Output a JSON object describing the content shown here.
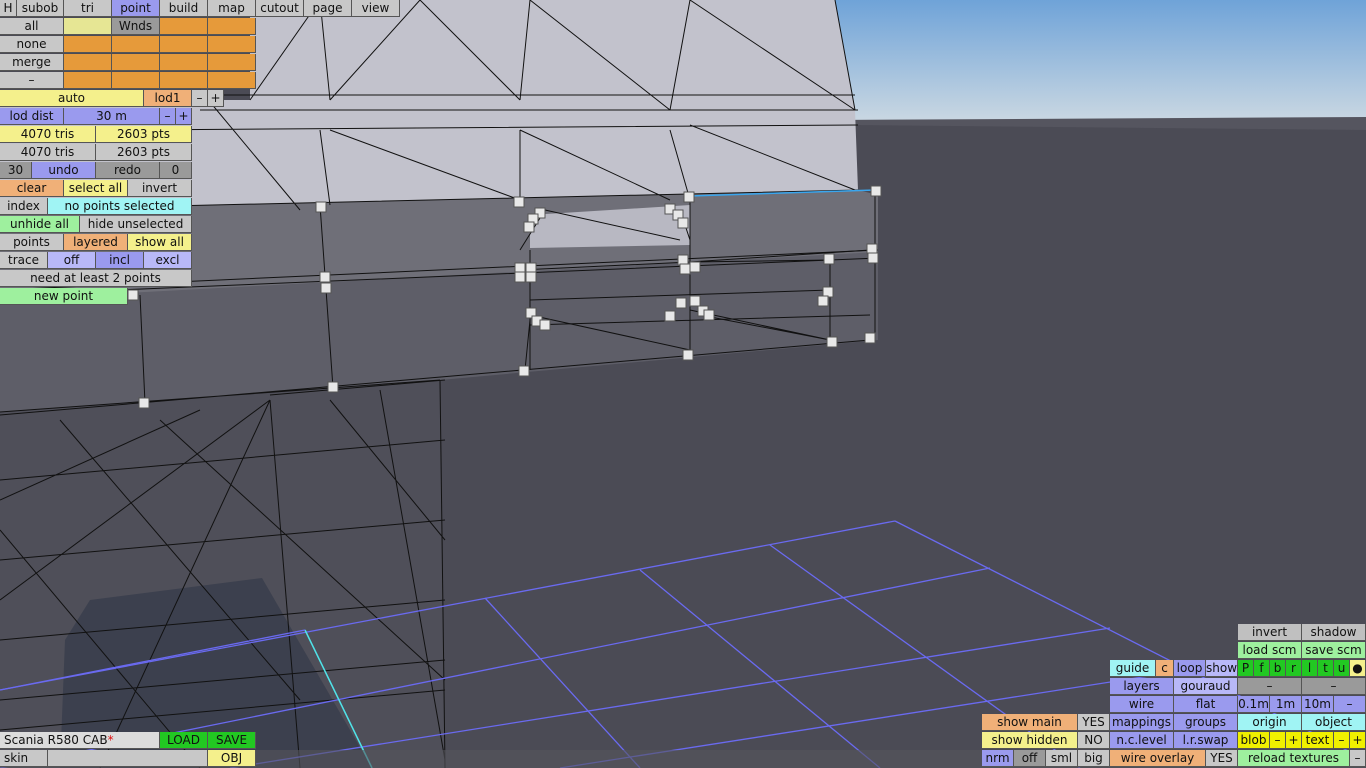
{
  "topbar": {
    "h": "H",
    "subob": "subob",
    "tri": "tri",
    "point": "point",
    "build": "build",
    "map": "map",
    "cutout": "cutout",
    "page": "page",
    "view": "view"
  },
  "selectors": {
    "all": "all",
    "none": "none",
    "merge": "merge",
    "minus": "–",
    "wnds": "Wnds"
  },
  "lod": {
    "auto": "auto",
    "lod1": "lod1",
    "minus": "–",
    "plus": "+",
    "dist_label": "lod dist",
    "dist_value": "30 m"
  },
  "stats": {
    "tris1": "4070 tris",
    "pts1": "2603 pts",
    "tris2": "4070 tris",
    "pts2": "2603 pts"
  },
  "undo": {
    "count": "30",
    "undo": "undo",
    "redo": "redo",
    "redo_count": "0"
  },
  "selection": {
    "clear": "clear",
    "select_all": "select all",
    "invert": "invert",
    "index": "index",
    "status": "no points selected",
    "unhide_all": "unhide all",
    "hide_unselected": "hide unselected",
    "points": "points",
    "layered": "layered",
    "show_all": "show all"
  },
  "trace": {
    "trace": "trace",
    "off": "off",
    "incl": "incl",
    "excl": "excl",
    "hint": "need at least 2 points",
    "new_point": "new point"
  },
  "model": {
    "name": "Scania R580 CAB",
    "modified": "*",
    "load": "LOAD",
    "save": "SAVE",
    "skin": "skin",
    "obj": "OBJ"
  },
  "right_panel": {
    "invert": "invert",
    "shadow": "shadow",
    "load_scm": "load scm",
    "save_scm": "save scm",
    "guide": "guide",
    "c": "c",
    "loop": "loop",
    "show": "show",
    "flags": [
      "P",
      "f",
      "b",
      "r",
      "l",
      "t",
      "u",
      "●"
    ],
    "layers": "layers",
    "gouraud": "gouraud",
    "dash1": "–",
    "dash2": "–",
    "wire": "wire",
    "flat": "flat",
    "grid1": "0.1m",
    "grid2": "1m",
    "grid3": "10m",
    "grid_minus": "–",
    "show_main": "show main",
    "show_main_val": "YES",
    "mappings": "mappings",
    "groups": "groups",
    "origin": "origin",
    "object": "object",
    "show_hidden": "show hidden",
    "show_hidden_val": "NO",
    "nc_level": "n.c.level",
    "lr_swap": "l.r.swap",
    "blob": "blob",
    "blob_minus": "–",
    "blob_plus": "+",
    "text": "text",
    "text_minus": "–",
    "text_plus": "+",
    "nrm": "nrm",
    "off": "off",
    "sml": "sml",
    "big": "big",
    "wire_overlay": "wire overlay",
    "wire_overlay_val": "YES",
    "reload_textures": "reload textures",
    "reload_minus": "–"
  },
  "colors": {
    "sky_top": "#6fa3d8",
    "sky_bottom": "#c9d7e2",
    "floor": "#4b4b55",
    "mesh_face": "#c2c2cc",
    "grid": "#6a6af0"
  }
}
